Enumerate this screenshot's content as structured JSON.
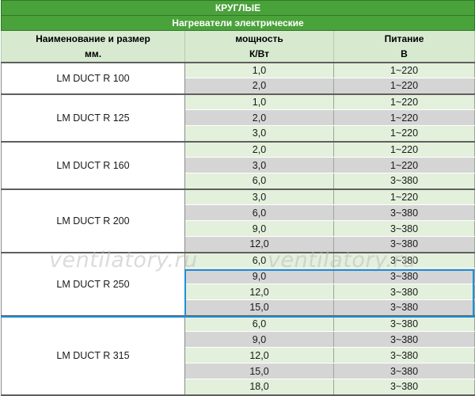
{
  "title": "КРУГЛЫЕ",
  "subtitle": "Нагреватели электрические",
  "headers": {
    "name": [
      "Наименование и размер",
      "мм."
    ],
    "power": [
      "мощность",
      "К/Вт"
    ],
    "supply": [
      "Питание",
      "В"
    ]
  },
  "groups": [
    {
      "model": "LM DUCT R 100",
      "rows": [
        {
          "power": "1,0",
          "supply": "1~220"
        },
        {
          "power": "2,0",
          "supply": "1~220"
        }
      ]
    },
    {
      "model": "LM DUCT R 125",
      "rows": [
        {
          "power": "1,0",
          "supply": "1~220"
        },
        {
          "power": "2,0",
          "supply": "1~220"
        },
        {
          "power": "3,0",
          "supply": "1~220"
        }
      ]
    },
    {
      "model": "LM DUCT R 160",
      "rows": [
        {
          "power": "2,0",
          "supply": "1~220"
        },
        {
          "power": "3,0",
          "supply": "1~220"
        },
        {
          "power": "6,0",
          "supply": "3~380"
        }
      ]
    },
    {
      "model": "LM DUCT R 200",
      "rows": [
        {
          "power": "3,0",
          "supply": "1~220"
        },
        {
          "power": "6,0",
          "supply": "3~380"
        },
        {
          "power": "9,0",
          "supply": "3~380"
        },
        {
          "power": "12,0",
          "supply": "3~380"
        }
      ]
    },
    {
      "model": "LM DUCT R 250",
      "rows": [
        {
          "power": "6,0",
          "supply": "3~380"
        },
        {
          "power": "9,0",
          "supply": "3~380"
        },
        {
          "power": "12,0",
          "supply": "3~380"
        },
        {
          "power": "15,0",
          "supply": "3~380"
        }
      ]
    },
    {
      "model": "LM DUCT R 315",
      "rows": [
        {
          "power": "6,0",
          "supply": "3~380"
        },
        {
          "power": "9,0",
          "supply": "3~380"
        },
        {
          "power": "12,0",
          "supply": "3~380"
        },
        {
          "power": "15,0",
          "supply": "3~380"
        },
        {
          "power": "18,0",
          "supply": "3~380"
        }
      ]
    }
  ],
  "watermark": "ventilatory.ru",
  "colors": {
    "title_band": "#4aa23a",
    "header_bg": "#d7ead0",
    "row_light": "#e3f0dc",
    "row_dark": "#d5d5d5",
    "selection_outline": "#1f8fd6"
  }
}
